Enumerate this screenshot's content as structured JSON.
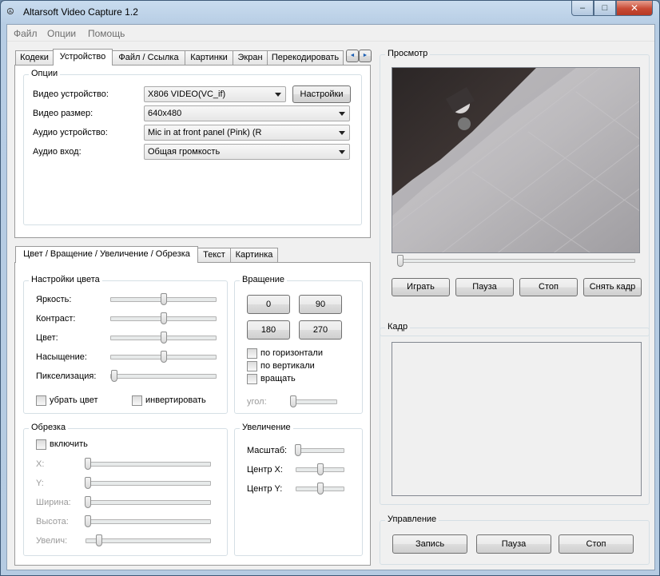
{
  "window": {
    "title": "Altarsoft Video Capture 1.2",
    "controls": {
      "minimize": "–",
      "maximize": "□",
      "close": "✕"
    }
  },
  "menu": [
    "Файл",
    "Опции",
    "Помощь"
  ],
  "top_tabs": {
    "items": [
      "Кодеки",
      "Устройство",
      "Файл / Ссылка",
      "Картинки",
      "Экран",
      "Перекодировать"
    ],
    "active": "Устройство",
    "scroll_left": "◄",
    "scroll_right": "►"
  },
  "options": {
    "group_title": "Опции",
    "video_device": {
      "label": "Видео устройство:",
      "value": "X806  VIDEO(VC_if)"
    },
    "settings_button": "Настройки",
    "video_size": {
      "label": "Видео размер:",
      "value": "640x480"
    },
    "audio_device": {
      "label": "Аудио устройство:",
      "value": "Mic in at front panel (Pink) (R"
    },
    "audio_input": {
      "label": "Аудио вход:",
      "value": "Общая громкость"
    }
  },
  "bottom_tabs": {
    "items": [
      "Цвет / Вращение / Увеличение / Обрезка",
      "Текст",
      "Картинка"
    ],
    "active": "Цвет / Вращение / Увеличение / Обрезка"
  },
  "color_settings": {
    "title": "Настройки цвета",
    "sliders": [
      {
        "label": "Яркость:",
        "level": 0.5
      },
      {
        "label": "Контраст:",
        "level": 0.5
      },
      {
        "label": "Цвет:",
        "level": 0.5
      },
      {
        "label": "Насыщение:",
        "level": 0.5
      },
      {
        "label": "Пикселизация:",
        "level": 0.03
      }
    ],
    "remove_color": "убрать цвет",
    "invert": "инвертировать"
  },
  "rotation": {
    "title": "Вращение",
    "buttons": [
      "0",
      "90",
      "180",
      "270"
    ],
    "flip_horizontal": "по горизонтали",
    "flip_vertical": "по вертикали",
    "rotate": "вращать",
    "angle": {
      "label": "угол:",
      "level": 0.03
    }
  },
  "crop": {
    "title": "Обрезка",
    "enable": "включить",
    "sliders": [
      {
        "label": "X:",
        "level": 0.01
      },
      {
        "label": "Y:",
        "level": 0.01
      },
      {
        "label": "Ширина:",
        "level": 0.01
      },
      {
        "label": "Высота:",
        "level": 0.01
      },
      {
        "label": "Увелич:",
        "level": 0.1
      }
    ]
  },
  "zoom": {
    "title": "Увеличение",
    "sliders": [
      {
        "label": "Масштаб:",
        "level": 0.03
      },
      {
        "label": "Центр X:",
        "level": 0.5
      },
      {
        "label": "Центр Y:",
        "level": 0.5
      }
    ]
  },
  "preview": {
    "title": "Просмотр",
    "position": 0.01,
    "buttons": [
      "Играть",
      "Пауза",
      "Стоп",
      "Снять кадр"
    ]
  },
  "frame": {
    "title": "Кадр"
  },
  "control": {
    "title": "Управление",
    "buttons": [
      "Запись",
      "Пауза",
      "Стоп"
    ]
  }
}
